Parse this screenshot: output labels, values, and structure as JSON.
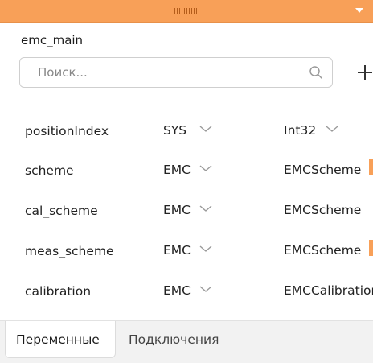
{
  "window": {
    "accent": "#f8a058"
  },
  "panel": {
    "title": "emc_main"
  },
  "search": {
    "placeholder": "Поиск...",
    "value": ""
  },
  "variables": [
    {
      "name": "positionIndex",
      "scope": "SYS",
      "type": "Int32"
    },
    {
      "name": "scheme",
      "scope": "EMC",
      "type": "EMCScheme"
    },
    {
      "name": "cal_scheme",
      "scope": "EMC",
      "type": "EMCScheme"
    },
    {
      "name": "meas_scheme",
      "scope": "EMC",
      "type": "EMCScheme"
    },
    {
      "name": "calibration",
      "scope": "EMC",
      "type": "EMCCalibration"
    }
  ],
  "tabs": [
    {
      "label": "Переменные",
      "active": true
    },
    {
      "label": "Подключения",
      "active": false
    }
  ],
  "icons": [
    "grip-handle-icon",
    "collapse-caret-icon",
    "search-icon",
    "add-icon",
    "chevron-down-icon"
  ]
}
